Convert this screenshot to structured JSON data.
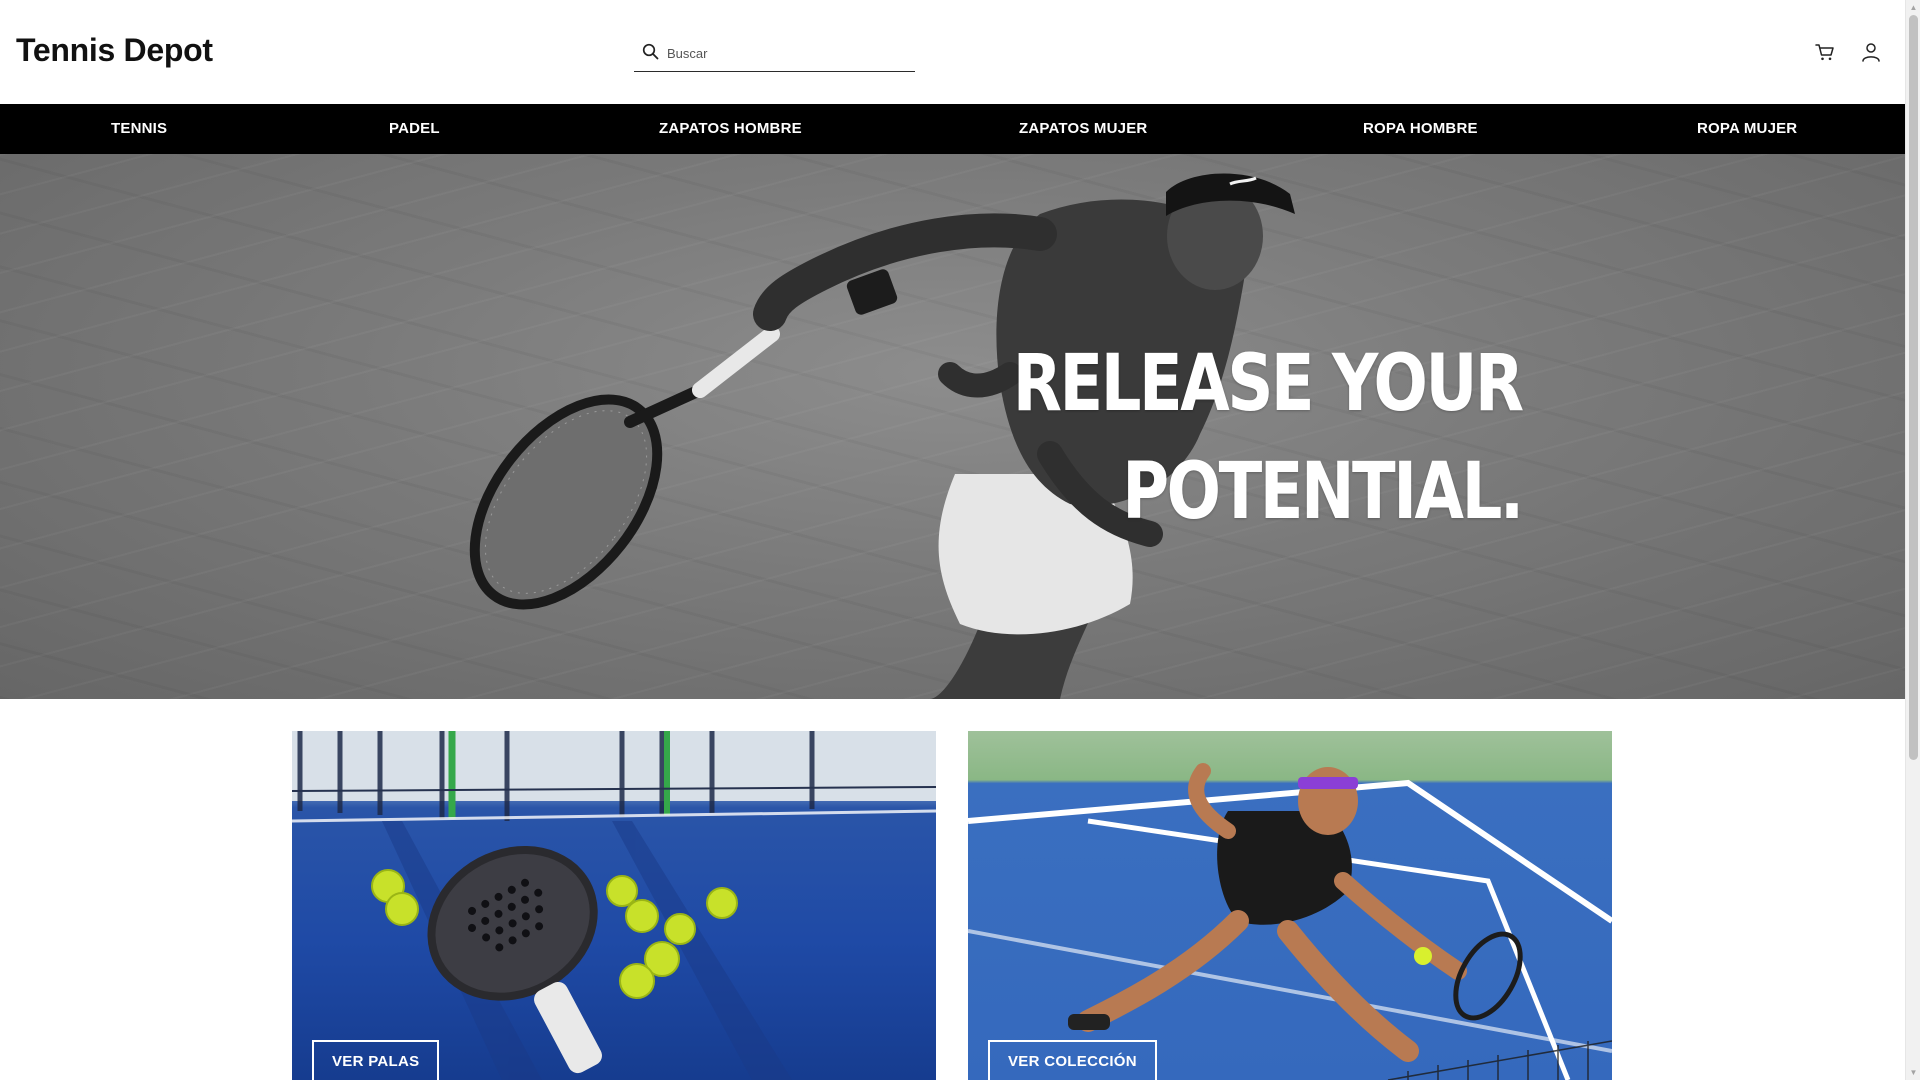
{
  "header": {
    "logo": "Tennis Depot",
    "search_placeholder": "Buscar",
    "icons": [
      "search-icon",
      "cart-icon",
      "user-icon"
    ]
  },
  "nav": {
    "items": [
      {
        "label": "TENNIS"
      },
      {
        "label": "PADEL"
      },
      {
        "label": "ZAPATOS HOMBRE"
      },
      {
        "label": "ZAPATOS MUJER"
      },
      {
        "label": "ROPA HOMBRE"
      },
      {
        "label": "ROPA MUJER"
      }
    ]
  },
  "hero": {
    "line1": "RELEASE YOUR",
    "line2": "POTENTIAL."
  },
  "cards": [
    {
      "button_label": "VER PALAS"
    },
    {
      "button_label": "VER COLECCIÓN"
    }
  ],
  "colors": {
    "nav_background": "#000000",
    "nav_text": "#ffffff",
    "page_background": "#ffffff",
    "logo_text": "#111111"
  }
}
